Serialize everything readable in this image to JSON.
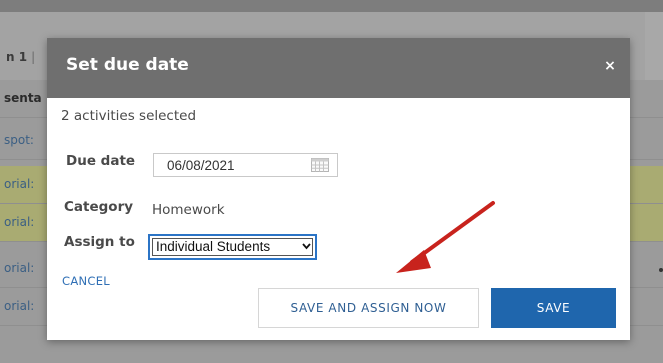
{
  "background": {
    "title": "n 1",
    "title_sep": "|",
    "header_row": "senta",
    "rows": [
      "spot:",
      "orial:",
      "orial:",
      "orial:",
      "orial:"
    ]
  },
  "modal": {
    "title": "Set due date",
    "close_glyph": "×",
    "selected_info": "2 activities selected",
    "due_date": {
      "label": "Due date",
      "value": "06/08/2021"
    },
    "category": {
      "label": "Category",
      "value": "Homework"
    },
    "assign_to": {
      "label": "Assign to",
      "value": "Individual Students"
    },
    "cancel_label": "CANCEL",
    "save_assign_label": "SAVE AND ASSIGN NOW",
    "save_label": "SAVE"
  },
  "colors": {
    "header_bg": "#6f6f6f",
    "primary": "#1f66ad",
    "link": "#2f6fb5",
    "annotation_arrow": "#c8231d"
  }
}
